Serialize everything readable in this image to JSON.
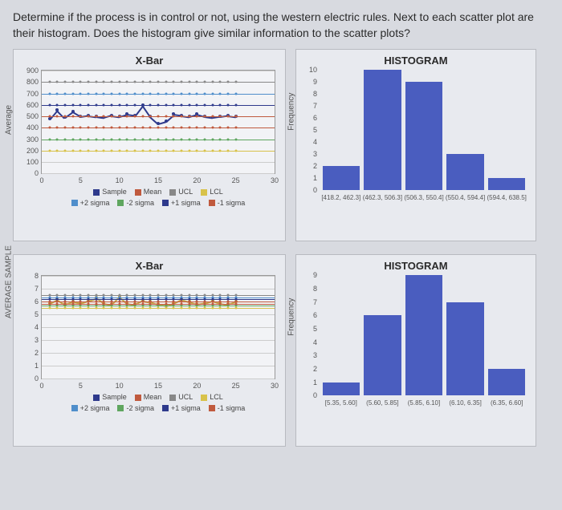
{
  "question": "Determine if the process is in control or not, using the western electric rules. Next to each scatter plot are their histogram. Does the histogram give similar information to the scatter plots?",
  "chart_data": [
    {
      "type": "line",
      "title": "X-Bar",
      "xlabel": "",
      "ylabel": "Average",
      "xlim": [
        0,
        30
      ],
      "ylim": [
        0,
        900
      ],
      "xticks": [
        0,
        5,
        10,
        15,
        20,
        25,
        30
      ],
      "yticks": [
        0,
        100,
        200,
        300,
        400,
        500,
        600,
        700,
        800,
        900
      ],
      "legend": [
        "Sample",
        "Mean",
        "UCL",
        "LCL",
        "+2 sigma",
        "-2 sigma",
        "+1 sigma",
        "-1 sigma"
      ],
      "series": [
        {
          "name": "Sample",
          "color": "#2e3a8c",
          "x": [
            1,
            2,
            3,
            4,
            5,
            6,
            7,
            8,
            9,
            10,
            11,
            12,
            13,
            14,
            15,
            16,
            17,
            18,
            19,
            20,
            21,
            22,
            23,
            24,
            25
          ],
          "y": [
            480,
            560,
            490,
            540,
            500,
            510,
            500,
            490,
            510,
            500,
            520,
            510,
            600,
            500,
            440,
            460,
            520,
            510,
            500,
            520,
            500,
            490,
            500,
            510,
            500
          ]
        },
        {
          "name": "Mean",
          "color": "#c05a3e",
          "const": 500
        },
        {
          "name": "UCL",
          "color": "#888",
          "const": 800
        },
        {
          "name": "LCL",
          "color": "#d8c24a",
          "const": 200
        },
        {
          "name": "+2 sigma",
          "color": "#4f8ecb",
          "const": 700
        },
        {
          "name": "-2 sigma",
          "color": "#5fa65f",
          "const": 300
        },
        {
          "name": "+1 sigma",
          "color": "#2e3a8c",
          "const": 600
        },
        {
          "name": "-1 sigma",
          "color": "#c05a3e",
          "const": 400
        }
      ]
    },
    {
      "type": "bar",
      "title": "HISTOGRAM",
      "xlabel": "",
      "ylabel": "Frequency",
      "ylim": [
        0,
        10
      ],
      "yticks": [
        0,
        1,
        2,
        3,
        4,
        5,
        6,
        7,
        8,
        9,
        10
      ],
      "categories": [
        "[418.2, 462.3]",
        "(462.3, 506.3]",
        "(506.3, 550.4]",
        "(550.4, 594.4]",
        "(594.4, 638.5]"
      ],
      "values": [
        2,
        10,
        9,
        3,
        1
      ]
    },
    {
      "type": "line",
      "title": "X-Bar",
      "xlabel": "",
      "ylabel": "AVERAGE SAMPLE",
      "xlim": [
        0,
        30
      ],
      "ylim": [
        0,
        8
      ],
      "xticks": [
        0,
        5,
        10,
        15,
        20,
        25,
        30
      ],
      "yticks": [
        0,
        1,
        2,
        3,
        4,
        5,
        6,
        7,
        8
      ],
      "legend": [
        "Sample",
        "Mean",
        "UCL",
        "LCL",
        "+2 sigma",
        "-2 sigma",
        "+1 sigma",
        "-1 sigma"
      ],
      "series": [
        {
          "name": "Sample",
          "color": "#c9a64b",
          "x": [
            1,
            2,
            3,
            4,
            5,
            6,
            7,
            8,
            9,
            10,
            11,
            12,
            13,
            14,
            15,
            16,
            17,
            18,
            19,
            20,
            21,
            22,
            23,
            24,
            25
          ],
          "y": [
            5.9,
            6.2,
            5.8,
            6.0,
            5.9,
            6.1,
            6.3,
            5.9,
            5.8,
            6.4,
            5.9,
            5.8,
            6.1,
            6.0,
            5.8,
            5.7,
            5.9,
            6.2,
            6.0,
            5.8,
            5.9,
            6.1,
            5.9,
            5.8,
            6.0
          ]
        },
        {
          "name": "Mean",
          "color": "#c05a3e",
          "const": 6.0
        },
        {
          "name": "UCL",
          "color": "#888",
          "const": 6.5
        },
        {
          "name": "LCL",
          "color": "#d8c24a",
          "const": 5.5
        },
        {
          "name": "+2 sigma",
          "color": "#4f8ecb",
          "const": 6.33
        },
        {
          "name": "-2 sigma",
          "color": "#5fa65f",
          "const": 5.67
        },
        {
          "name": "+1 sigma",
          "color": "#2e3a8c",
          "const": 6.17
        },
        {
          "name": "-1 sigma",
          "color": "#c05a3e",
          "const": 5.83
        }
      ]
    },
    {
      "type": "bar",
      "title": "HISTOGRAM",
      "xlabel": "",
      "ylabel": "Frequency",
      "ylim": [
        0,
        9
      ],
      "yticks": [
        0,
        1,
        2,
        3,
        4,
        5,
        6,
        7,
        8,
        9
      ],
      "categories": [
        "[5.35, 5.60]",
        "(5.60, 5.85]",
        "(5.85, 6.10]",
        "(6.10, 6.35]",
        "(6.35, 6.60]"
      ],
      "values": [
        1,
        6,
        9,
        7,
        2
      ]
    }
  ],
  "legend_colors": {
    "Sample": "#2e3a8c",
    "Mean": "#c05a3e",
    "UCL": "#888",
    "LCL": "#d8c24a",
    "+2 sigma": "#4f8ecb",
    "-2 sigma": "#5fa65f",
    "+1 sigma": "#2e3a8c",
    "-1 sigma": "#c05a3e"
  }
}
